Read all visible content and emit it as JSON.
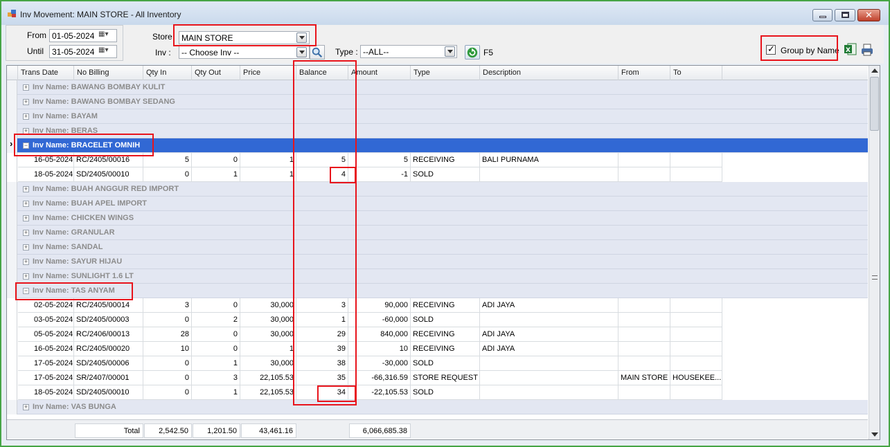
{
  "window": {
    "title": "Inv Movement: MAIN STORE - All Inventory"
  },
  "filters": {
    "from_label": "From",
    "from_value": "01-05-2024",
    "until_label": "Until",
    "until_value": "31-05-2024",
    "store_label": "Store",
    "store_value": "MAIN STORE",
    "inv_label": "Inv :",
    "inv_value": "-- Choose Inv --",
    "type_label": "Type :",
    "type_value": "--ALL--",
    "refresh_label": "F5",
    "group_by_label": "Group by Name",
    "group_by_checked": true
  },
  "grid": {
    "columns": [
      "Trans Date",
      "No Billing",
      "Qty In",
      "Qty Out",
      "Price",
      "Balance",
      "Amount",
      "Type",
      "Description",
      "From",
      "To"
    ],
    "rows": [
      {
        "kind": "group",
        "label": "Inv Name: BAWANG BOMBAY KULIT",
        "expanded": false
      },
      {
        "kind": "group",
        "label": "Inv Name: BAWANG BOMBAY SEDANG",
        "expanded": false
      },
      {
        "kind": "group",
        "label": "Inv Name: BAYAM",
        "expanded": false
      },
      {
        "kind": "group",
        "label": "Inv Name: BERAS",
        "expanded": false
      },
      {
        "kind": "group",
        "label": "Inv Name: BRACELET OMNIH",
        "expanded": true,
        "selected": true
      },
      {
        "kind": "data",
        "cells": [
          "16-05-2024",
          "RC/2405/00016",
          "5",
          "0",
          "1",
          "5",
          "5",
          "RECEIVING",
          "BALI PURNAMA",
          "",
          ""
        ]
      },
      {
        "kind": "data",
        "cells": [
          "18-05-2024",
          "SD/2405/00010",
          "0",
          "1",
          "1",
          "4",
          "-1",
          "SOLD",
          "",
          "",
          ""
        ]
      },
      {
        "kind": "group",
        "label": "Inv Name: BUAH ANGGUR RED IMPORT",
        "expanded": false
      },
      {
        "kind": "group",
        "label": "Inv Name: BUAH APEL IMPORT",
        "expanded": false
      },
      {
        "kind": "group",
        "label": "Inv Name: CHICKEN WINGS",
        "expanded": false
      },
      {
        "kind": "group",
        "label": "Inv Name: GRANULAR",
        "expanded": false
      },
      {
        "kind": "group",
        "label": "Inv Name: SANDAL",
        "expanded": false
      },
      {
        "kind": "group",
        "label": "Inv Name: SAYUR HIJAU",
        "expanded": false
      },
      {
        "kind": "group",
        "label": "Inv Name: SUNLIGHT 1.6 LT",
        "expanded": false
      },
      {
        "kind": "group",
        "label": "Inv Name: TAS ANYAM",
        "expanded": true
      },
      {
        "kind": "data",
        "cells": [
          "02-05-2024",
          "RC/2405/00014",
          "3",
          "0",
          "30,000",
          "3",
          "90,000",
          "RECEIVING",
          "ADI JAYA",
          "",
          ""
        ]
      },
      {
        "kind": "data",
        "cells": [
          "03-05-2024",
          "SD/2405/00003",
          "0",
          "2",
          "30,000",
          "1",
          "-60,000",
          "SOLD",
          "",
          "",
          ""
        ]
      },
      {
        "kind": "data",
        "cells": [
          "05-05-2024",
          "RC/2406/00013",
          "28",
          "0",
          "30,000",
          "29",
          "840,000",
          "RECEIVING",
          "ADI JAYA",
          "",
          ""
        ]
      },
      {
        "kind": "data",
        "cells": [
          "16-05-2024",
          "RC/2405/00020",
          "10",
          "0",
          "1",
          "39",
          "10",
          "RECEIVING",
          "ADI JAYA",
          "",
          ""
        ]
      },
      {
        "kind": "data",
        "cells": [
          "17-05-2024",
          "SD/2405/00006",
          "0",
          "1",
          "30,000",
          "38",
          "-30,000",
          "SOLD",
          "",
          "",
          ""
        ]
      },
      {
        "kind": "data",
        "cells": [
          "17-05-2024",
          "SR/2407/00001",
          "0",
          "3",
          "22,105.53",
          "35",
          "-66,316.59",
          "STORE REQUEST",
          "",
          "MAIN STORE",
          "HOUSEKEE..."
        ]
      },
      {
        "kind": "data",
        "cells": [
          "18-05-2024",
          "SD/2405/00010",
          "0",
          "1",
          "22,105.53",
          "34",
          "-22,105.53",
          "SOLD",
          "",
          "",
          ""
        ]
      },
      {
        "kind": "group",
        "label": "Inv Name: VAS BUNGA",
        "expanded": false
      }
    ],
    "footer": {
      "total_label": "Total",
      "qty_in": "2,542.50",
      "qty_out": "1,201.50",
      "price": "43,461.16",
      "amount": "6,066,685.38"
    }
  },
  "colors": {
    "selection": "#3168d4",
    "group_row": "#e3e7f2",
    "highlight_box": "#e8141c",
    "window_border": "#46a546"
  }
}
